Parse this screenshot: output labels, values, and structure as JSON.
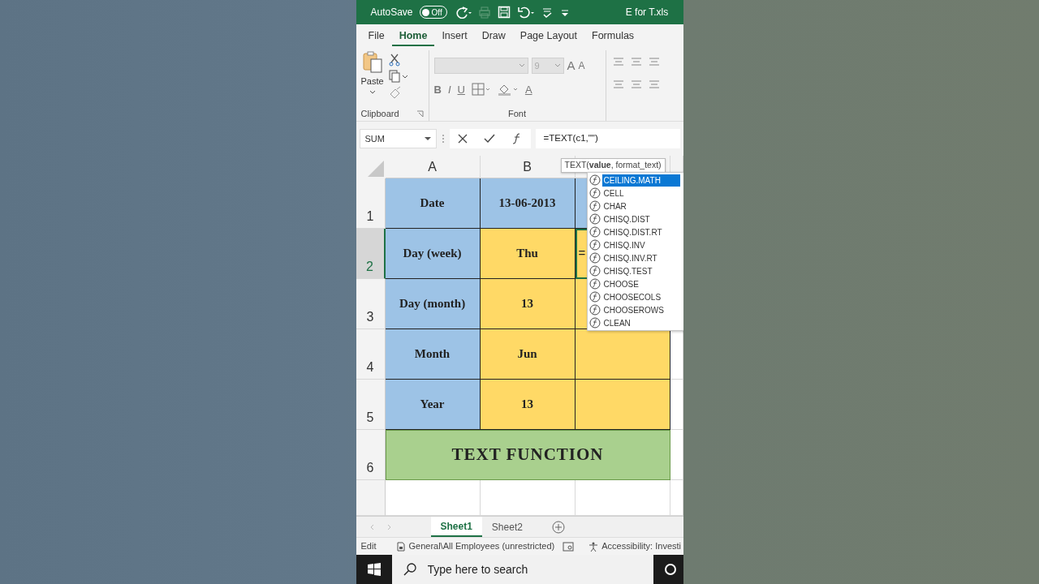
{
  "title_bar": {
    "autosave_label": "AutoSave",
    "autosave_toggle": {
      "label": "Off",
      "on": false
    },
    "file_name": "E for T.xls"
  },
  "ribbon_tabs": [
    {
      "label": "File",
      "selected": false
    },
    {
      "label": "Home",
      "selected": true
    },
    {
      "label": "Insert",
      "selected": false
    },
    {
      "label": "Draw",
      "selected": false
    },
    {
      "label": "Page Layout",
      "selected": false
    },
    {
      "label": "Formulas",
      "selected": false
    }
  ],
  "ribbon": {
    "paste_label": "Paste",
    "clipboard_label": "Clipboard",
    "font_label": "Font",
    "font_size": "9",
    "grow_font": "A",
    "shrink_font": "A",
    "bold": "B",
    "italic": "I",
    "underline": "U",
    "font_color": "A"
  },
  "formula_bar": {
    "name_box": "SUM",
    "formula": "=TEXT(c1,\"\")"
  },
  "tooltip": "TEXT(**value**, format_text)",
  "autocomplete": [
    {
      "label": "CEILING.MATH",
      "selected": true
    },
    {
      "label": "CELL",
      "selected": false
    },
    {
      "label": "CHAR",
      "selected": false
    },
    {
      "label": "CHISQ.DIST",
      "selected": false
    },
    {
      "label": "CHISQ.DIST.RT",
      "selected": false
    },
    {
      "label": "CHISQ.INV",
      "selected": false
    },
    {
      "label": "CHISQ.INV.RT",
      "selected": false
    },
    {
      "label": "CHISQ.TEST",
      "selected": false
    },
    {
      "label": "CHOOSE",
      "selected": false
    },
    {
      "label": "CHOOSECOLS",
      "selected": false
    },
    {
      "label": "CHOOSEROWS",
      "selected": false
    },
    {
      "label": "CLEAN",
      "selected": false
    }
  ],
  "sheet": {
    "columns": [
      "A",
      "B"
    ],
    "rows": [
      {
        "header": "1",
        "selected": false,
        "cells": [
          {
            "text": "Date",
            "color": "#9dc3e6"
          },
          {
            "text": "13-06-2013",
            "color": "#9dc3e6"
          },
          {
            "color": "#9dc3e6"
          }
        ]
      },
      {
        "header": "2",
        "selected": true,
        "cells": [
          {
            "text": "Day (week)",
            "color": "#9dc3e6"
          },
          {
            "text": "Thu",
            "color": "#ffd966"
          },
          {
            "text": "=",
            "color": "#ffd966"
          }
        ]
      },
      {
        "header": "3",
        "selected": false,
        "cells": [
          {
            "text": "Day (month)",
            "color": "#9dc3e6"
          },
          {
            "text": "13",
            "color": "#ffd966"
          },
          {
            "color": "#ffd966"
          }
        ]
      },
      {
        "header": "4",
        "selected": false,
        "cells": [
          {
            "text": "Month",
            "color": "#9dc3e6"
          },
          {
            "text": "Jun",
            "color": "#ffd966"
          },
          {
            "color": "#ffd966"
          }
        ]
      },
      {
        "header": "5",
        "selected": false,
        "cells": [
          {
            "text": "Year",
            "color": "#9dc3e6"
          },
          {
            "text": "13",
            "color": "#ffd966"
          },
          {
            "color": "#ffd966"
          }
        ]
      }
    ],
    "merged_row": {
      "header": "6",
      "text": "TEXT FUNCTION",
      "color": "#a9d08e"
    }
  },
  "sheet_tabs": [
    {
      "label": "Sheet1",
      "selected": true
    },
    {
      "label": "Sheet2",
      "selected": false
    }
  ],
  "status_bar": {
    "mode": "Edit",
    "sensitivity": "General\\All Employees (unrestricted)",
    "accessibility": "Accessibility: Investi"
  },
  "taskbar": {
    "search_placeholder": "Type here to search"
  }
}
